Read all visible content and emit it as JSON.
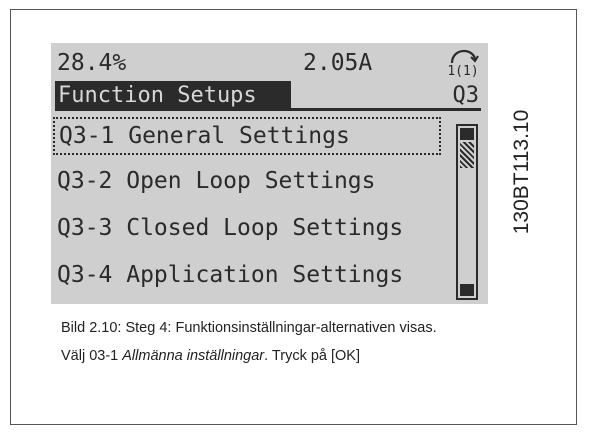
{
  "lcd": {
    "status_left": "28.4%",
    "status_mid": "2.05A",
    "status_icon": "hand-on-icon",
    "status_icon_text": "1(1)",
    "title": "Function Setups",
    "title_code": "Q3",
    "menu_items": [
      {
        "label": "Q3-1 General Settings",
        "selected": true
      },
      {
        "label": "Q3-2 Open Loop Settings",
        "selected": false
      },
      {
        "label": "Q3-3 Closed Loop Settings",
        "selected": false
      },
      {
        "label": "Q3-4 Application Settings",
        "selected": false
      }
    ],
    "colors": {
      "background": "#cfcfcf",
      "foreground": "#2a2a2a"
    }
  },
  "figure_code": "130BT113.10",
  "caption": {
    "line1": "Bild 2.10: Steg 4: Funktionsinställningar-alternativen visas.",
    "line2_prefix": "Välj 03-1 ",
    "line2_italic": "Allmänna inställningar",
    "line2_suffix": ".  Tryck på [OK]"
  }
}
